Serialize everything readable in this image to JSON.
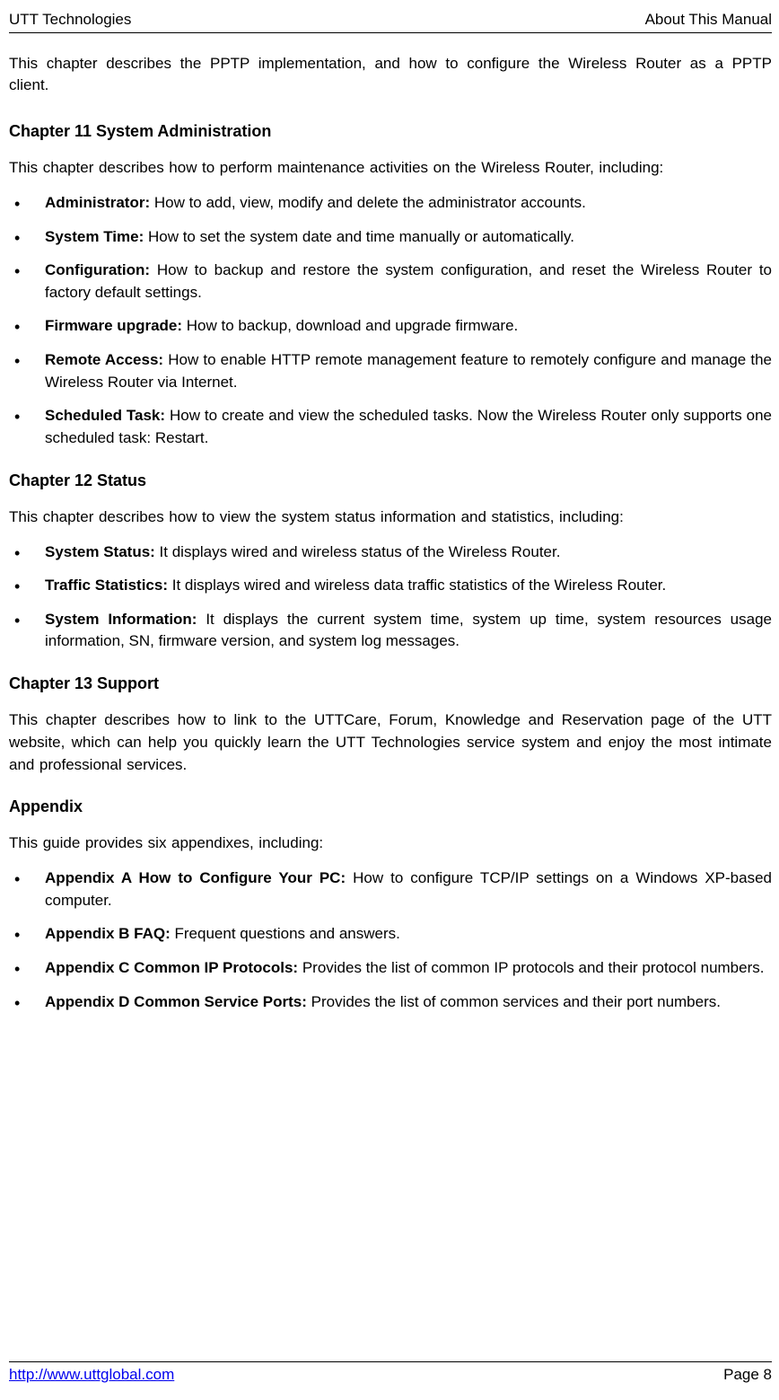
{
  "header": {
    "left": "UTT Technologies",
    "right": "About This Manual"
  },
  "intro": "This chapter describes the PPTP implementation, and how to configure the Wireless Router as a PPTP client.",
  "sections": [
    {
      "title": "Chapter 11 System Administration",
      "desc": "This chapter describes how to perform maintenance activities on the Wireless Router, including:",
      "items": [
        {
          "bold": "Administrator:",
          "text": " How to add, view, modify and delete the administrator accounts."
        },
        {
          "bold": "System Time:",
          "text": " How to set the system date and time manually or automatically."
        },
        {
          "bold": "Configuration:",
          "text": " How to backup and restore the system configuration, and reset the Wireless Router to factory default settings."
        },
        {
          "bold": "Firmware upgrade:",
          "text": " How to backup, download and upgrade firmware."
        },
        {
          "bold": "Remote Access:",
          "text": " How to enable HTTP remote management feature to remotely configure and manage the Wireless Router via Internet."
        },
        {
          "bold": "Scheduled Task:",
          "text": " How to create and view the scheduled tasks. Now the Wireless Router only supports one scheduled task: Restart."
        }
      ]
    },
    {
      "title": "Chapter 12 Status",
      "desc": "This chapter describes how to view the system status information and statistics, including:",
      "items": [
        {
          "bold": "System Status:",
          "text": " It displays wired and wireless status of the Wireless Router."
        },
        {
          "bold": "Traffic Statistics:",
          "text": " It displays wired and wireless data traffic statistics of the Wireless Router."
        },
        {
          "bold": "System Information:",
          "text": " It displays the current system time, system up time, system resources usage information, SN, firmware version, and system log messages."
        }
      ]
    },
    {
      "title": "Chapter 13 Support",
      "desc": "This chapter describes how to link to the UTTCare, Forum, Knowledge and Reservation page of the UTT website, which can help you quickly learn the UTT Technologies service system and enjoy the most intimate and professional services.",
      "items": []
    },
    {
      "title": "Appendix",
      "desc": "This guide provides six appendixes, including:",
      "items": [
        {
          "bold": "Appendix A How to Configure Your PC:",
          "text": " How to configure TCP/IP settings on a Windows XP-based computer."
        },
        {
          "bold": "Appendix B FAQ:",
          "text": " Frequent questions and answers."
        },
        {
          "bold": "Appendix C Common IP Protocols:",
          "text": " Provides the list of common IP protocols and their protocol numbers."
        },
        {
          "bold": "Appendix D Common Service Ports:",
          "text": " Provides the list of common services and their port numbers."
        }
      ]
    }
  ],
  "footer": {
    "link": "http://www.uttglobal.com",
    "page": "Page 8"
  }
}
